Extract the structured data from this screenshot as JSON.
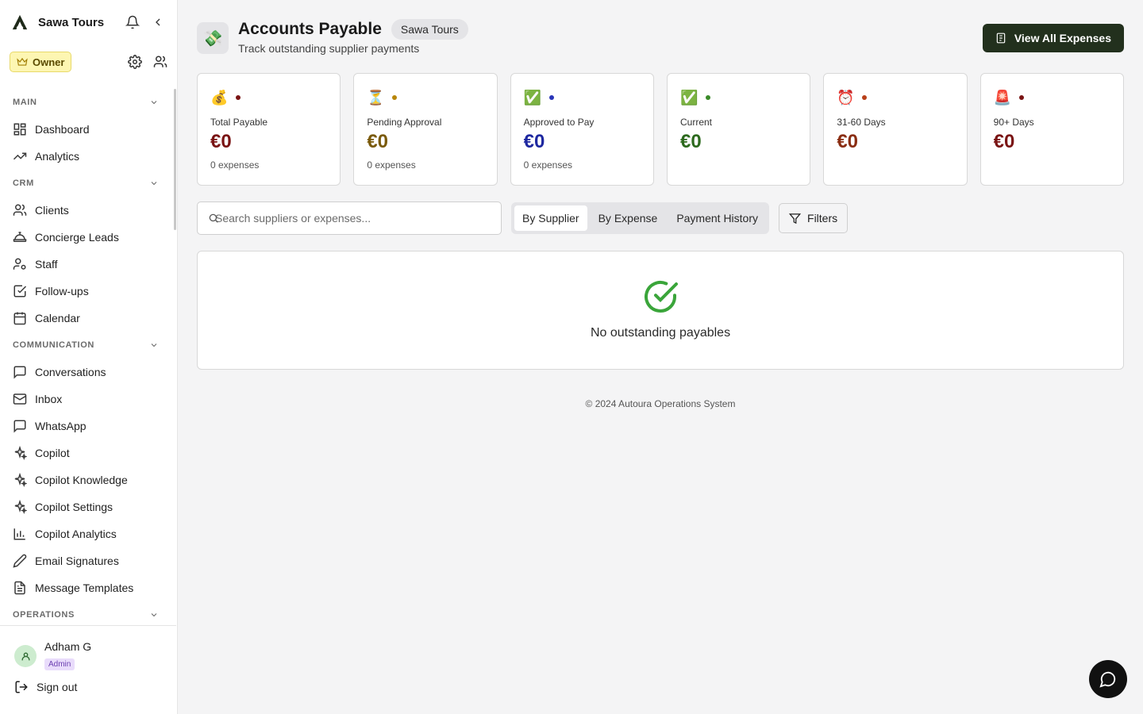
{
  "sidebar": {
    "brand": "Sawa Tours",
    "role_badge": "Owner",
    "sections": [
      {
        "title": "MAIN",
        "items": [
          "Dashboard",
          "Analytics"
        ]
      },
      {
        "title": "CRM",
        "items": [
          "Clients",
          "Concierge Leads",
          "Staff",
          "Follow-ups",
          "Calendar"
        ]
      },
      {
        "title": "COMMUNICATION",
        "items": [
          "Conversations",
          "Inbox",
          "WhatsApp",
          "Copilot",
          "Copilot Knowledge",
          "Copilot Settings",
          "Copilot Analytics",
          "Email Signatures",
          "Message Templates"
        ]
      },
      {
        "title": "OPERATIONS",
        "items": []
      }
    ],
    "user": {
      "name": "Adham G",
      "role": "Admin"
    },
    "sign_out": "Sign out"
  },
  "header": {
    "title": "Accounts Payable",
    "org": "Sawa Tours",
    "subtitle": "Track outstanding supplier payments",
    "view_all_label": "View All Expenses"
  },
  "cards": [
    {
      "emoji": "💰",
      "label": "Total Payable",
      "value": "€0",
      "count": "0 expenses",
      "color": "#7a1414"
    },
    {
      "emoji": "⏳",
      "label": "Pending Approval",
      "value": "€0",
      "count": "0 expenses",
      "color": "#7a5a0a"
    },
    {
      "emoji": "✅",
      "label": "Approved to Pay",
      "value": "€0",
      "count": "0 expenses",
      "color": "#1e28a0"
    },
    {
      "emoji": "✅",
      "label": "Current",
      "value": "€0",
      "count": "",
      "color": "#2d6a1e"
    },
    {
      "emoji": "⏰",
      "label": "31-60 Days",
      "value": "€0",
      "count": "",
      "color": "#8a2d12"
    },
    {
      "emoji": "🚨",
      "label": "90+ Days",
      "value": "€0",
      "count": "",
      "color": "#7a1414"
    }
  ],
  "search": {
    "placeholder": "Search suppliers or expenses..."
  },
  "tabs": [
    "By Supplier",
    "By Expense",
    "Payment History"
  ],
  "filters_label": "Filters",
  "empty_state": "No outstanding payables",
  "footer": "© 2024 Autoura Operations System"
}
